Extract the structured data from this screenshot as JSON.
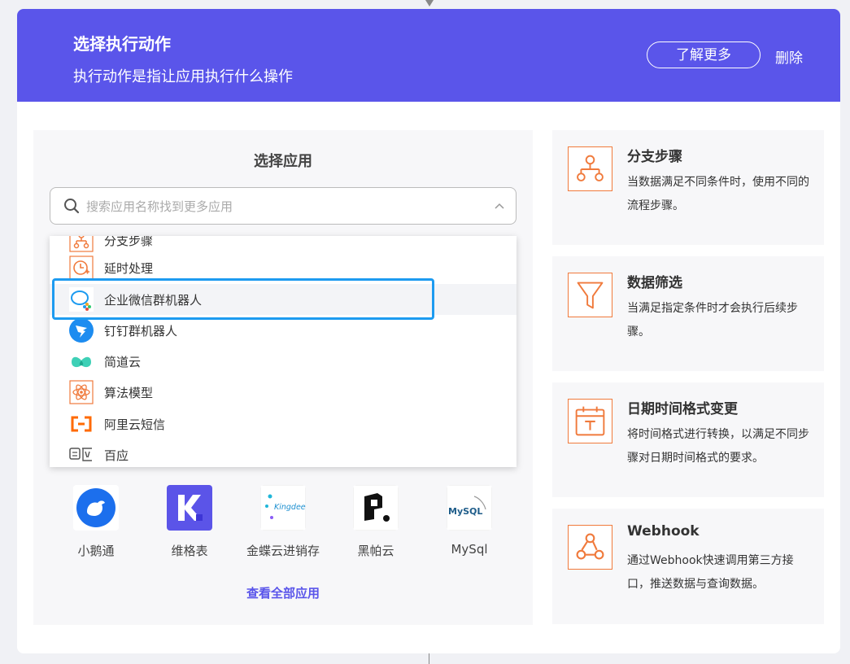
{
  "header": {
    "title": "选择执行动作",
    "subtitle": "执行动作是指让应用执行什么操作",
    "learn_more": "了解更多",
    "delete": "删除"
  },
  "left_panel": {
    "title": "选择应用",
    "search_placeholder": "搜索应用名称找到更多应用",
    "dropdown_items": [
      {
        "label": "分支步骤",
        "icon": "branch-icon"
      },
      {
        "label": "延时处理",
        "icon": "clock-delay-icon"
      },
      {
        "label": "企业微信群机器人",
        "icon": "wecom-robot-icon",
        "selected": true
      },
      {
        "label": "钉钉群机器人",
        "icon": "dingtalk-icon"
      },
      {
        "label": "简道云",
        "icon": "jiandaoyun-icon"
      },
      {
        "label": "算法模型",
        "icon": "atom-icon"
      },
      {
        "label": "阿里云短信",
        "icon": "aliyun-icon"
      },
      {
        "label": "百应",
        "icon": "baiying-icon"
      }
    ],
    "apps": [
      {
        "label": "小鹅通",
        "icon": "xiaoetong-icon"
      },
      {
        "label": "维格表",
        "icon": "vika-icon"
      },
      {
        "label": "金蝶云进销存",
        "icon": "kingdee-icon",
        "logo_text": "Kingdee"
      },
      {
        "label": "黑帕云",
        "icon": "heipayun-icon"
      },
      {
        "label": "MySql",
        "icon": "mysql-icon",
        "logo_text": "MySQL"
      }
    ],
    "view_all": "查看全部应用"
  },
  "features": [
    {
      "title": "分支步骤",
      "desc": "当数据满足不同条件时，使用不同的流程步骤。",
      "icon": "branch-icon"
    },
    {
      "title": "数据筛选",
      "desc": "当满足指定条件时才会执行后续步骤。",
      "icon": "filter-funnel-icon"
    },
    {
      "title": "日期时间格式变更",
      "desc": "将时间格式进行转换，以满足不同步骤对日期时间格式的要求。",
      "icon": "calendar-icon"
    },
    {
      "title": "Webhook",
      "desc": "通过Webhook快速调用第三方接口，推送数据与查询数据。",
      "icon": "webhook-icon"
    }
  ],
  "colors": {
    "header_bg": "#5a55ea",
    "accent_orange": "#f07a3c",
    "highlight_blue": "#1d9bf0"
  }
}
